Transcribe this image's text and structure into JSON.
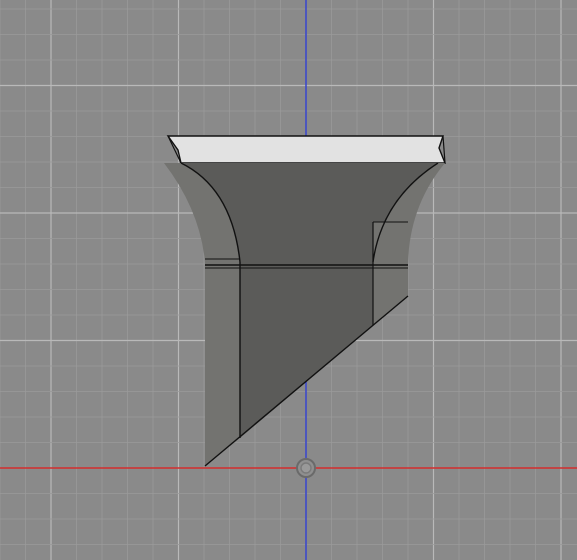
{
  "viewport": {
    "view_orientation": "front",
    "background_color": "#8a8a8a",
    "grid": {
      "visible": true,
      "minor_color": "#9a9a9a",
      "major_color": "#b9b9b9"
    },
    "axes": {
      "x_axis_color": "#d02a2a",
      "y_axis_color": "#2e3ccf"
    },
    "origin_marker": {
      "visible": true,
      "icon": "origin-circle-icon"
    },
    "model": {
      "name": "",
      "shape": "flared-pedestal-with-angled-cut",
      "body_color": "#5b5b59",
      "top_face_color": "#e2e2e2",
      "side_face_color": "#737370",
      "edge_color": "#111111"
    }
  }
}
